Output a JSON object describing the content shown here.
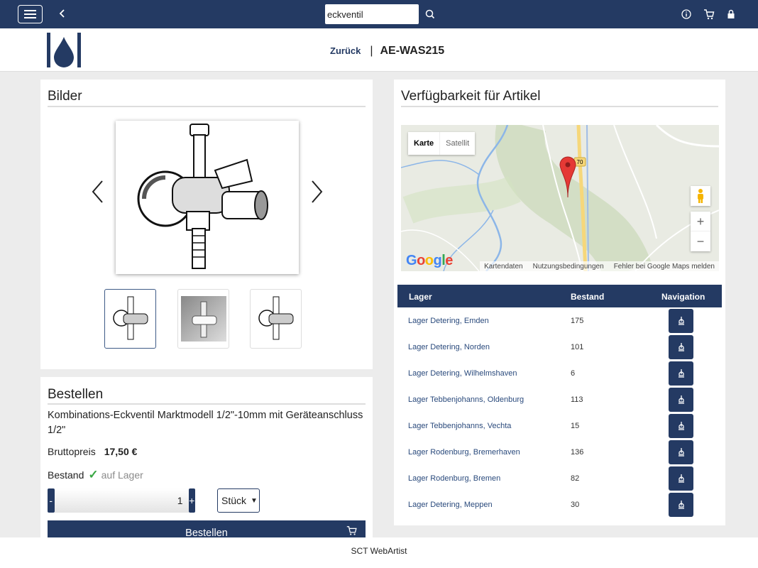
{
  "topbar": {
    "search_value": "eckventil",
    "icons": [
      "menu-icon",
      "back-arrow-icon",
      "search-icon",
      "info-icon",
      "cart-icon",
      "lock-icon"
    ]
  },
  "subheader": {
    "back_label": "Zurück",
    "separator": "|",
    "article_number": "AE-WAS215"
  },
  "images_panel": {
    "title": "Bilder",
    "thumbnails": 3,
    "active_thumbnail": 1
  },
  "order_panel": {
    "title": "Bestellen",
    "product_name": "Kombinations-Eckventil Marktmodell 1/2\"-10mm mit Geräteanschluss 1/2\"",
    "price_label": "Bruttopreis",
    "price_value": "17,50 €",
    "stock_label": "Bestand",
    "stock_status": "auf Lager",
    "qty_minus": "-",
    "qty_plus": "+",
    "quantity": "1",
    "unit": "Stück",
    "order_button": "Bestellen"
  },
  "availability_panel": {
    "title": "Verfügbarkeit für Artikel",
    "map": {
      "type_map": "Karte",
      "type_satellite": "Satellit",
      "zoom_in": "+",
      "zoom_out": "−",
      "google": "Google",
      "footer_data": "Kartendaten",
      "footer_terms": "Nutzungsbedingungen",
      "footer_report": "Fehler bei Google Maps melden",
      "road_label": "70"
    },
    "table": {
      "headers": {
        "lager": "Lager",
        "bestand": "Bestand",
        "navigation": "Navigation"
      },
      "rows": [
        {
          "lager": "Lager Detering, Emden",
          "bestand": "175"
        },
        {
          "lager": "Lager Detering, Norden",
          "bestand": "101"
        },
        {
          "lager": "Lager Detering, Wilhelmshaven",
          "bestand": "6"
        },
        {
          "lager": "Lager Tebbenjohanns, Oldenburg",
          "bestand": "113"
        },
        {
          "lager": "Lager Tebbenjohanns, Vechta",
          "bestand": "15"
        },
        {
          "lager": "Lager Rodenburg, Bremerhaven",
          "bestand": "136"
        },
        {
          "lager": "Lager Rodenburg, Bremen",
          "bestand": "82"
        },
        {
          "lager": "Lager Detering, Meppen",
          "bestand": "30"
        }
      ]
    }
  },
  "footer": {
    "text": "SCT WebArtist"
  },
  "colors": {
    "brand": "#243a63",
    "check": "#3aa845",
    "link": "#2a4a7c"
  }
}
